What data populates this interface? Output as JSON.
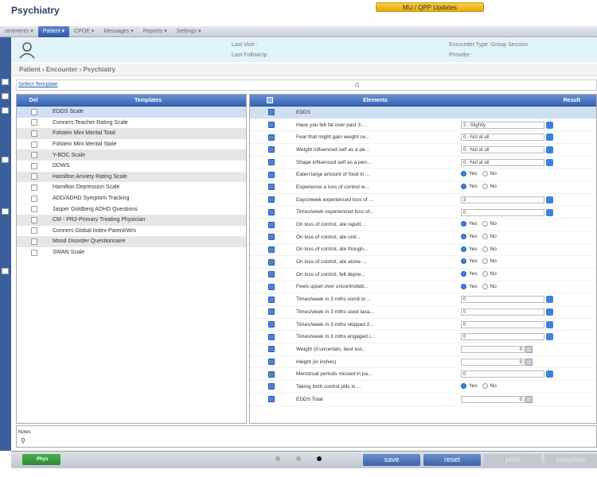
{
  "app": {
    "title": "Psychiatry",
    "mu_button": "MU / QPP Updates"
  },
  "menubar": [
    "ointments ▾",
    "Patient ▾",
    "CPOE ▾",
    "Messages ▾",
    "Reports ▾",
    "Settings ▾"
  ],
  "patient": {
    "last_visit": "Last Visit :",
    "last_followup": "Last FollowUp",
    "encounter_type": "Encounter Type :Group Session",
    "provider": "Provider :"
  },
  "breadcrumb": "Patient  ›  Encounter  ›  Psychiatry",
  "select_template": "Select Template",
  "left": {
    "col_del": "Del",
    "col_templates": "Templates",
    "items": [
      "EDDS Scale",
      "Conners Teacher Rating Scale",
      "Folstein Mini Mental Total",
      "Folstein Mini Mental State",
      "Y-BOC Scale",
      "DDWS",
      "Hamilton Anxiety Rating Scale",
      "Hamilton Depression Scale",
      "ADD/ADHD Symptom Tracking",
      "Jasper Goldberg ADHD Questions",
      "CM - PR2-Primary Treating Physician",
      "Conners Global Index-Parent/Wrs",
      "Mood Disorder Questionnaire",
      "SWAN Scale"
    ]
  },
  "right": {
    "col_elements": "Elements",
    "col_result": "Result",
    "section": "EDDS",
    "rows": [
      {
        "label": "Have you felt fat over past 3 ...",
        "type": "select",
        "value": "2 - Slightly"
      },
      {
        "label": "Fear that might gain weight ov...",
        "type": "select",
        "value": "0 - Not at all"
      },
      {
        "label": "Weight influenced self as a pe...",
        "type": "select",
        "value": "0 - Not at all"
      },
      {
        "label": "Shape influenced self as a pen...",
        "type": "select",
        "value": "0 - Not at all"
      },
      {
        "label": "Eaten large amount of food in ...",
        "type": "yn",
        "value": "Yes"
      },
      {
        "label": "Experience a loss of control w...",
        "type": "yn",
        "value": "Yes"
      },
      {
        "label": "Days/week experienced loss of ...",
        "type": "select",
        "value": "3"
      },
      {
        "label": "Times/week experienced loss of...",
        "type": "select",
        "value": "0"
      },
      {
        "label": "On loss of control, ate rapidl...",
        "type": "yn",
        "value": "Yes"
      },
      {
        "label": "On loss of control, ate unti...",
        "type": "yn",
        "value": "Yes"
      },
      {
        "label": "On loss of control, ate though...",
        "type": "yn",
        "value": "Yes"
      },
      {
        "label": "On loss of control, ate alone ...",
        "type": "yn",
        "value": "Yes"
      },
      {
        "label": "On loss of control, felt depre...",
        "type": "yn",
        "value": "Yes"
      },
      {
        "label": "Feels upset over uncontrollab...",
        "type": "yn",
        "value": "Yes"
      },
      {
        "label": "Times/week in 3 mths vomit to ...",
        "type": "select",
        "value": "0"
      },
      {
        "label": "Times/week in 3 mths used laxa...",
        "type": "select",
        "value": "0"
      },
      {
        "label": "Times/week in 3 mths skipped 2...",
        "type": "select",
        "value": "0"
      },
      {
        "label": "Times/week in 3 mths engaged i...",
        "type": "select",
        "value": "0"
      },
      {
        "label": "Weight (if uncertain, best est...",
        "type": "num",
        "value": "0"
      },
      {
        "label": "Height (in inches)",
        "type": "num",
        "value": "0"
      },
      {
        "label": "Menstrual periods missed in pa...",
        "type": "select",
        "value": "0"
      },
      {
        "label": "Taking birth control pills in ...",
        "type": "yn",
        "value": "Yes"
      },
      {
        "label": "EDDS Total",
        "type": "num",
        "value": "0"
      }
    ]
  },
  "yn": {
    "yes": "Yes",
    "no": "No"
  },
  "notes_label": "Notes",
  "bottom": {
    "phys": "Phys",
    "save": "save",
    "reset": "reset",
    "print": "print",
    "complete": "complete"
  }
}
